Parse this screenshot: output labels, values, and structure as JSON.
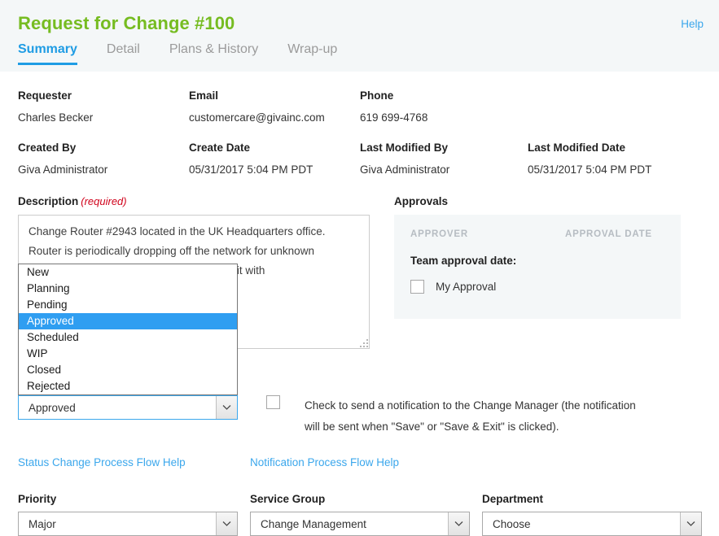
{
  "header": {
    "title": "Request for Change #100",
    "help_label": "Help",
    "tabs": [
      {
        "label": "Summary",
        "active": true
      },
      {
        "label": "Detail",
        "active": false
      },
      {
        "label": "Plans & History",
        "active": false
      },
      {
        "label": "Wrap-up",
        "active": false
      }
    ]
  },
  "meta": {
    "requester_label": "Requester",
    "requester_value": "Charles Becker",
    "email_label": "Email",
    "email_value": "customercare@givainc.com",
    "phone_label": "Phone",
    "phone_value": "619 699-4768",
    "created_by_label": "Created By",
    "created_by_value": "Giva Administrator",
    "create_date_label": "Create Date",
    "create_date_value": "05/31/2017 5:04 PM PDT",
    "last_modified_by_label": "Last Modified By",
    "last_modified_by_value": "Giva Administrator",
    "last_modified_date_label": "Last Modified Date",
    "last_modified_date_value": "05/31/2017 5:04 PM PDT"
  },
  "description": {
    "label": "Description",
    "required_tag": "(required)",
    "value": "Change Router #2943 located in the UK Headquarters office.\nRouter is periodically dropping off the network for unknown\nreasons. Plan is to replace it with a new unit with\nadditional ports and memory."
  },
  "approvals": {
    "title": "Approvals",
    "col_approver": "APPROVER",
    "col_approval_date": "APPROVAL DATE",
    "team_approval_label": "Team approval date:",
    "my_approval_label": "My Approval",
    "my_approval_checked": false
  },
  "status": {
    "selected": "Approved",
    "options": [
      "New",
      "Planning",
      "Pending",
      "Approved",
      "Scheduled",
      "WIP",
      "Closed",
      "Rejected"
    ],
    "highlighted": "Approved"
  },
  "notification": {
    "checked": false,
    "line1": "Check to send a notification to the Change Manager (the notification",
    "line2": "will be sent when \"Save\" or \"Save & Exit\" is clicked)."
  },
  "links": {
    "status_flow": "Status Change Process Flow Help",
    "notification_flow": "Notification Process Flow Help"
  },
  "bottom_fields": {
    "priority_label": "Priority",
    "priority_value": "Major",
    "service_group_label": "Service Group",
    "service_group_value": "Change Management",
    "department_label": "Department",
    "department_value": "Choose"
  },
  "colors": {
    "title_green": "#76bc21",
    "link_blue": "#3ba7ec",
    "tab_active_blue": "#1f9ce4",
    "required_red": "#d0021b",
    "dropdown_highlight": "#2f9ef1",
    "panel_bg": "#f4f7f8"
  }
}
